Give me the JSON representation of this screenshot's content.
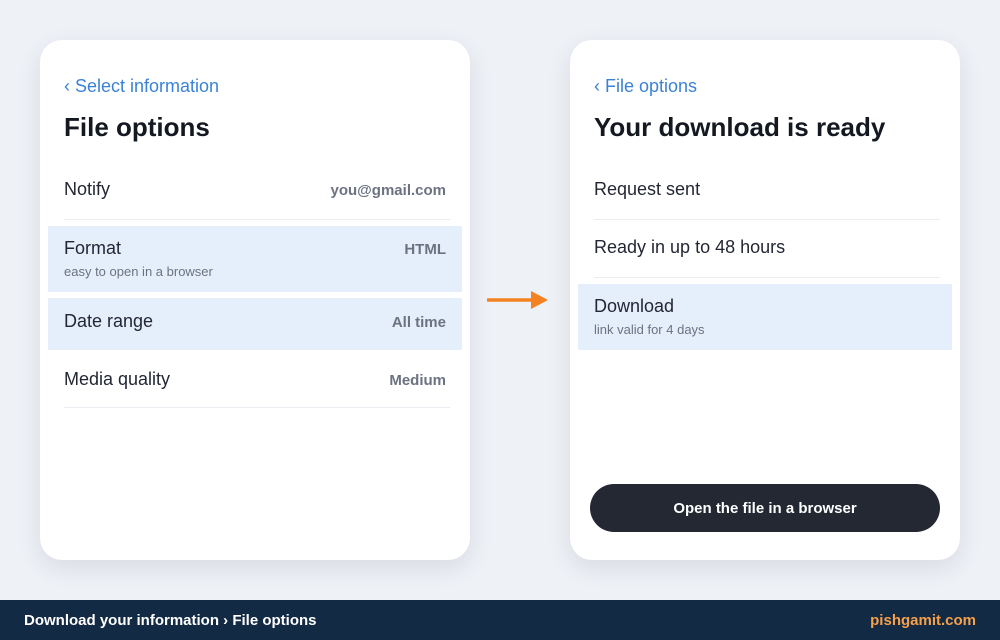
{
  "left_panel": {
    "back_link": "‹ Select information",
    "title": "File options",
    "rows": [
      {
        "label": "Notify",
        "value": "you@gmail.com"
      },
      {
        "label": "Format",
        "sub": "easy to open in a browser",
        "value": "HTML",
        "selected": true
      },
      {
        "label": "Date range",
        "value": "All time",
        "selected": true
      },
      {
        "label": "Media quality",
        "value": "Medium"
      }
    ]
  },
  "right_panel": {
    "back_link": "‹ File options",
    "title": "Your download is ready",
    "rows": [
      {
        "label": "Request sent"
      },
      {
        "label": "Ready in up to 48 hours"
      },
      {
        "label": "Download",
        "sub": "link valid for 4 days",
        "selected": true
      }
    ],
    "button_label": "Open the file in a browser"
  },
  "footer": {
    "breadcrumb": "Download your information › File options",
    "brand": "pishgamit.com"
  },
  "colors": {
    "accent_link": "#3b82d6",
    "selected_row_bg": "#e5eefb",
    "arrow": "#f58220",
    "button_bg": "#242833",
    "footer_bg": "#132a45",
    "brand": "#f5a04a"
  },
  "icons": {
    "flow_arrow": "arrow-right-icon"
  }
}
